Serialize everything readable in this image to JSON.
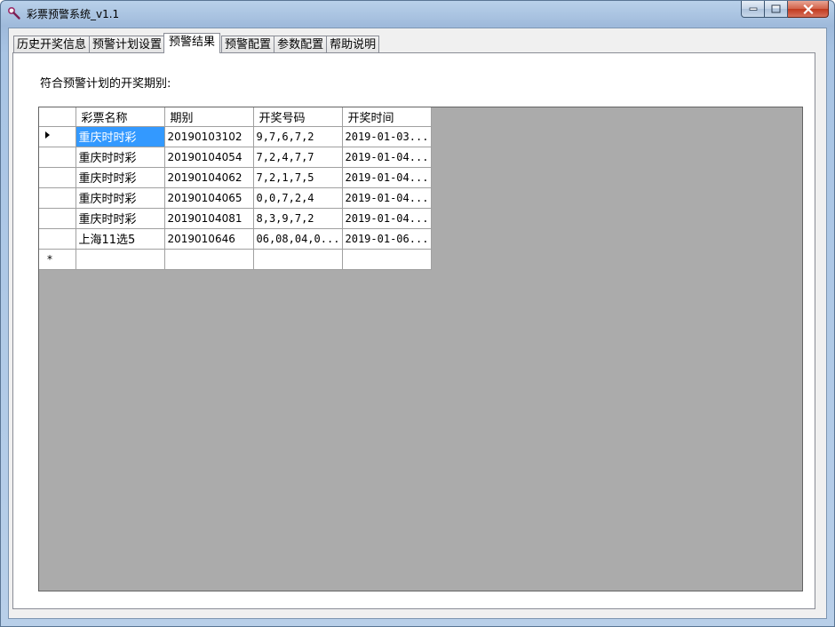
{
  "window": {
    "title": "彩票预警系统_v1.1",
    "accent": "#3399ff"
  },
  "tabs": [
    {
      "label": "历史开奖信息",
      "active": false
    },
    {
      "label": "预警计划设置",
      "active": false
    },
    {
      "label": "预警结果",
      "active": true
    },
    {
      "label": "预警配置",
      "active": false
    },
    {
      "label": "参数配置",
      "active": false
    },
    {
      "label": "帮助说明",
      "active": false
    }
  ],
  "results": {
    "label": "符合预警计划的开奖期别:",
    "columns": [
      "彩票名称",
      "期别",
      "开奖号码",
      "开奖时间"
    ],
    "rows": [
      {
        "name": "重庆时时彩",
        "period": "20190103102",
        "numbers": "9,7,6,7,2",
        "time": "2019-01-03..."
      },
      {
        "name": "重庆时时彩",
        "period": "20190104054",
        "numbers": "7,2,4,7,7",
        "time": "2019-01-04..."
      },
      {
        "name": "重庆时时彩",
        "period": "20190104062",
        "numbers": "7,2,1,7,5",
        "time": "2019-01-04..."
      },
      {
        "name": "重庆时时彩",
        "period": "20190104065",
        "numbers": "0,0,7,2,4",
        "time": "2019-01-04..."
      },
      {
        "name": "重庆时时彩",
        "period": "20190104081",
        "numbers": "8,3,9,7,2",
        "time": "2019-01-04..."
      },
      {
        "name": "上海11选5",
        "period": "2019010646",
        "numbers": "06,08,04,0...",
        "time": "2019-01-06..."
      }
    ],
    "new_row_marker": "*"
  }
}
